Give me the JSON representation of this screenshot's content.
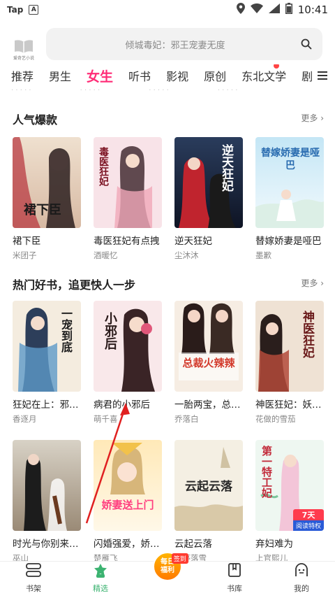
{
  "status_bar": {
    "app": "Tap",
    "badge": "A",
    "time": "10:41"
  },
  "header": {
    "logo_text": "爱奇艺小说",
    "search_placeholder": "倾城毒妃：邪王宠妻无度"
  },
  "tabs": [
    {
      "label": "推荐",
      "active": false
    },
    {
      "label": "男生",
      "active": false
    },
    {
      "label": "女生",
      "active": true
    },
    {
      "label": "听书",
      "active": false
    },
    {
      "label": "影视",
      "active": false
    },
    {
      "label": "原创",
      "active": false
    },
    {
      "label": "东北文学",
      "active": false,
      "dot": true
    },
    {
      "label": "剧",
      "active": false
    }
  ],
  "sections": [
    {
      "title": "人气爆款",
      "more": "更多",
      "books": [
        {
          "title": "裙下臣",
          "author": "米团子",
          "cover_text": "裙下臣",
          "bg": [
            "#e8d8c8",
            "#c04a50"
          ]
        },
        {
          "title": "毒医狂妃有点拽",
          "author": "酒暖忆",
          "cover_text": "毒医狂妃",
          "bg": [
            "#f6dbe2",
            "#e6a6b4"
          ]
        },
        {
          "title": "逆天狂妃",
          "author": "尘沐沐",
          "cover_text": "逆天狂妃",
          "bg": [
            "#1c2a4a",
            "#b3202a"
          ]
        },
        {
          "title": "替嫁娇妻是哑巴",
          "author": "墨歉",
          "cover_text": "替嫁娇妻是哑巴",
          "bg": [
            "#bfe3f3",
            "#eaf6fb"
          ]
        }
      ]
    },
    {
      "title": "热门好书，追更快人一步",
      "more": "更多",
      "books": [
        {
          "title": "狂妃在上：邪王...",
          "author": "香逐月",
          "cover_text": "一宠到底",
          "bg": [
            "#f3eadf",
            "#4b89b8"
          ]
        },
        {
          "title": "病君的小邪后",
          "author": "萌千喜",
          "cover_text": "小邪后",
          "bg": [
            "#f8e6e8",
            "#dba2ae"
          ]
        },
        {
          "title": "一胎两宝，总裁...",
          "author": "乔落白",
          "cover_text": "总裁火辣辣",
          "bg": [
            "#f6ede3",
            "#d33a2c"
          ]
        },
        {
          "title": "神医狂妃：妖孽...",
          "author": "花做的雪茄",
          "cover_text": "神医狂妃",
          "bg": [
            "#efe3d6",
            "#b34a3a"
          ]
        },
        {
          "title": "时光与你别来无...",
          "author": "巫山",
          "cover_text": "",
          "bg": [
            "#d9d0c2",
            "#6b5a48"
          ]
        },
        {
          "title": "闪婚强爱，娇妻...",
          "author": "楚雁飞",
          "cover_text": "娇妻送上门",
          "bg": [
            "#fff2d0",
            "#ff8bb5"
          ]
        },
        {
          "title": "云起云落",
          "author": "长亭落雪",
          "cover_text": "云起云落",
          "bg": [
            "#f4efe3",
            "#c9b896"
          ]
        },
        {
          "title": "弃妇难为",
          "author": "上官熙儿",
          "cover_text": "第一特工妃",
          "bg": [
            "#eaf6ef",
            "#f3c5d8"
          ],
          "badge_top": "7天",
          "badge_bottom": "阅读特权"
        }
      ]
    }
  ],
  "bottom_nav": [
    {
      "label": "书架",
      "icon": "bookshelf-icon",
      "active": false
    },
    {
      "label": "精选",
      "icon": "featured-icon",
      "active": true
    },
    {
      "label": "",
      "icon": "daily-welfare-icon",
      "active": false,
      "daily_line1": "每日",
      "daily_line2": "福利",
      "badge": "签到"
    },
    {
      "label": "书库",
      "icon": "library-icon",
      "active": false
    },
    {
      "label": "我的",
      "icon": "profile-icon",
      "active": false
    }
  ],
  "colors": {
    "accent": "#ff2d77",
    "active_nav": "#3cb371",
    "arrow": "#e02020"
  }
}
